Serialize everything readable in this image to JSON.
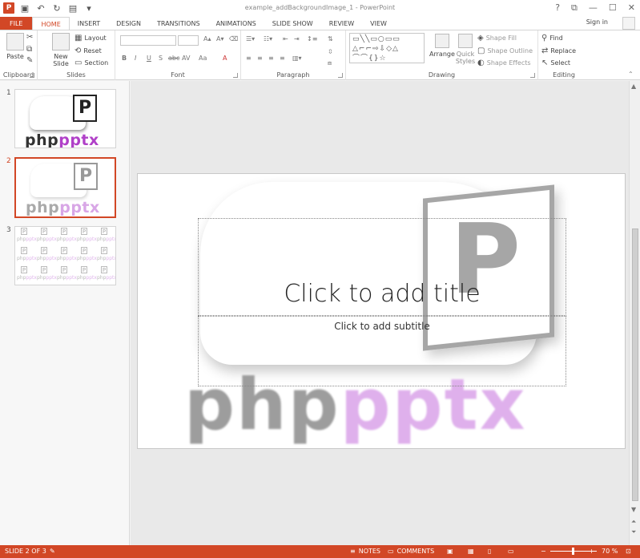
{
  "window_title": "example_addBackgroundImage_1 - PowerPoint",
  "window_controls": [
    "?",
    "⧉",
    "—",
    "☐",
    "✕"
  ],
  "tabs": [
    {
      "label": "FILE"
    },
    {
      "label": "HOME"
    },
    {
      "label": "INSERT"
    },
    {
      "label": "DESIGN"
    },
    {
      "label": "TRANSITIONS"
    },
    {
      "label": "ANIMATIONS"
    },
    {
      "label": "SLIDE SHOW"
    },
    {
      "label": "REVIEW"
    },
    {
      "label": "VIEW"
    }
  ],
  "active_tab": "HOME",
  "sign_in": "Sign in",
  "ribbon": {
    "clipboard": {
      "paste": "Paste",
      "label": "Clipboard"
    },
    "slides": {
      "new_slide": "New Slide",
      "layout": "Layout",
      "reset": "Reset",
      "section": "Section",
      "label": "Slides"
    },
    "font": {
      "label": "Font",
      "buttons": [
        "B",
        "I",
        "U",
        "S",
        "abc",
        "AV",
        "Aa",
        "A"
      ]
    },
    "paragraph": {
      "label": "Paragraph"
    },
    "drawing": {
      "arrange": "Arrange",
      "quick_styles": "Quick Styles",
      "shape_fill": "Shape Fill",
      "shape_outline": "Shape Outline",
      "shape_effects": "Shape Effects",
      "label": "Drawing"
    },
    "editing": {
      "find": "Find",
      "replace": "Replace",
      "select": "Select",
      "label": "Editing"
    }
  },
  "thumbnails": [
    {
      "number": "1",
      "logo_php": "php",
      "logo_pptx": "pptx",
      "selected": false
    },
    {
      "number": "2",
      "logo_php": "php",
      "logo_pptx": "pptx",
      "selected": true
    },
    {
      "number": "3",
      "tile_php": "php",
      "tile_pptx": "pptx",
      "selected": false
    }
  ],
  "slide": {
    "title_placeholder": "Click to add title",
    "subtitle_placeholder": "Click to add subtitle",
    "bg_logo_php": "php",
    "bg_logo_pptx": "pptx",
    "bg_p": "P"
  },
  "status": {
    "slide_info": "SLIDE 2 OF 3",
    "notes": "NOTES",
    "comments": "COMMENTS",
    "zoom": "70 %"
  },
  "colors": {
    "accent": "#d24726",
    "brand_pptx": "#b040c8"
  }
}
